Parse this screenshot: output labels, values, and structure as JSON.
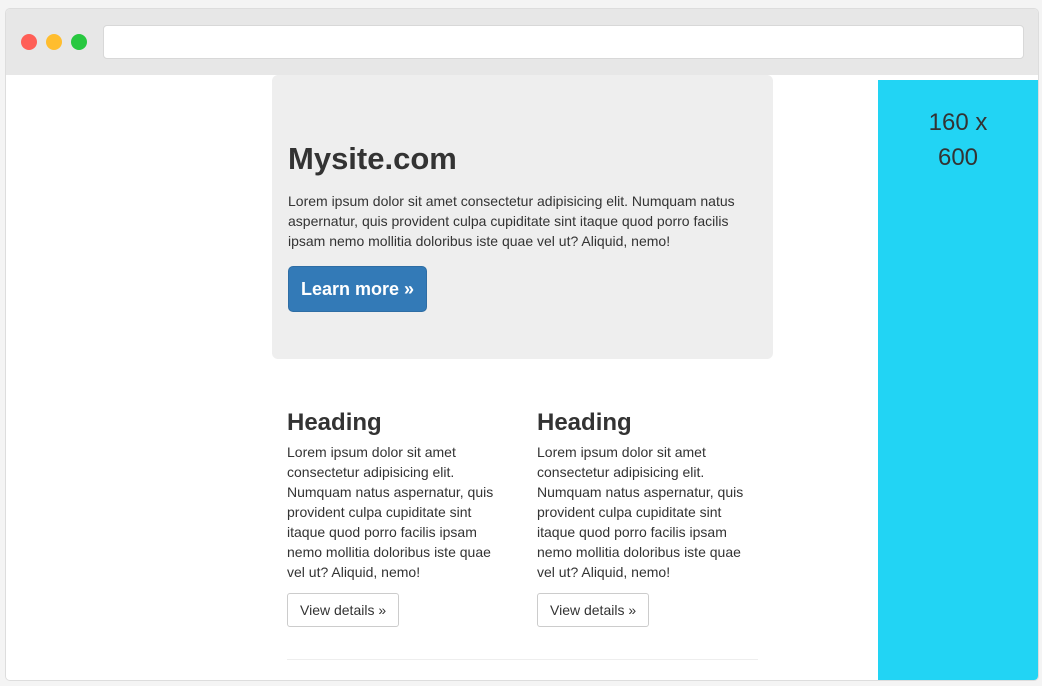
{
  "window": {
    "traffic_lights": [
      "red",
      "yellow",
      "green"
    ],
    "colors": {
      "close": "#ff5f57",
      "minimize": "#ffbd2e",
      "maximize": "#28c840"
    },
    "address_bar": {
      "value": "",
      "placeholder": ""
    }
  },
  "jumbotron": {
    "title": "Mysite.com",
    "text": "Lorem ipsum dolor sit amet consectetur adipisicing elit. Numquam natus aspernatur, quis provident culpa cupiditate sint itaque quod porro facilis ipsam nemo mollitia doloribus iste quae vel ut? Aliquid, nemo!",
    "button_label": "Learn more »",
    "button_color": "#337ab7"
  },
  "features": [
    {
      "heading": "Heading",
      "text": "Lorem ipsum dolor sit amet consectetur adipisicing elit. Numquam natus aspernatur, quis provident culpa cupiditate sint itaque quod porro facilis ipsam nemo mollitia doloribus iste quae vel ut? Aliquid, nemo!",
      "button_label": "View details »"
    },
    {
      "heading": "Heading",
      "text": "Lorem ipsum dolor sit amet consectetur adipisicing elit. Numquam natus aspernatur, quis provident culpa cupiditate sint itaque quod porro facilis ipsam nemo mollitia doloribus iste quae vel ut? Aliquid, nemo!",
      "button_label": "View details »"
    }
  ],
  "advertisement": {
    "line_1": "160 x",
    "line_2": "600",
    "color": "#22d4f4"
  }
}
